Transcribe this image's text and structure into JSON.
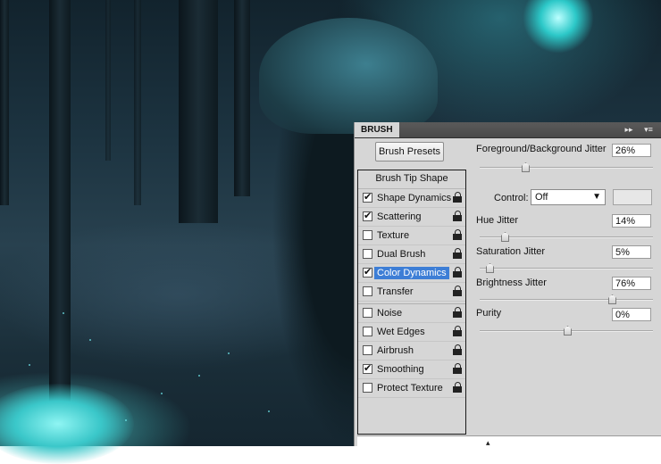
{
  "panel": {
    "tab_label": "BRUSH",
    "collapse_icon": "double-arrow-icon",
    "menu_icon": "panel-menu-icon",
    "brush_presets_label": "Brush Presets",
    "tip_shape_label": "Brush Tip Shape",
    "options": [
      {
        "label": "Shape Dynamics",
        "checked": true,
        "locked": true
      },
      {
        "label": "Scattering",
        "checked": true,
        "locked": true
      },
      {
        "label": "Texture",
        "checked": false,
        "locked": true
      },
      {
        "label": "Dual Brush",
        "checked": false,
        "locked": true
      },
      {
        "label": "Color Dynamics",
        "checked": true,
        "locked": true,
        "selected": true
      },
      {
        "label": "Transfer",
        "checked": false,
        "locked": true
      },
      {
        "label": "Noise",
        "checked": false,
        "locked": true
      },
      {
        "label": "Wet Edges",
        "checked": false,
        "locked": true
      },
      {
        "label": "Airbrush",
        "checked": false,
        "locked": true
      },
      {
        "label": "Smoothing",
        "checked": true,
        "locked": true
      },
      {
        "label": "Protect Texture",
        "checked": false,
        "locked": true
      }
    ],
    "check_mark": "✔"
  },
  "settings": {
    "fg_bg_jitter": {
      "label": "Foreground/Background Jitter",
      "value": "26%",
      "level": 0.26
    },
    "control": {
      "label": "Control:",
      "value": "Off"
    },
    "hue_jitter": {
      "label": "Hue Jitter",
      "value": "14%",
      "level": 0.14
    },
    "saturation_jitter": {
      "label": "Saturation Jitter",
      "value": "5%",
      "level": 0.05
    },
    "brightness_jitter": {
      "label": "Brightness Jitter",
      "value": "76%",
      "level": 0.76
    },
    "purity": {
      "label": "Purity",
      "value": "0%",
      "level": 0.5
    }
  },
  "colors": {
    "panel_bg": "#d6d6d6",
    "selection": "#3d7ed6",
    "background_accent": "#3ac7c9"
  }
}
